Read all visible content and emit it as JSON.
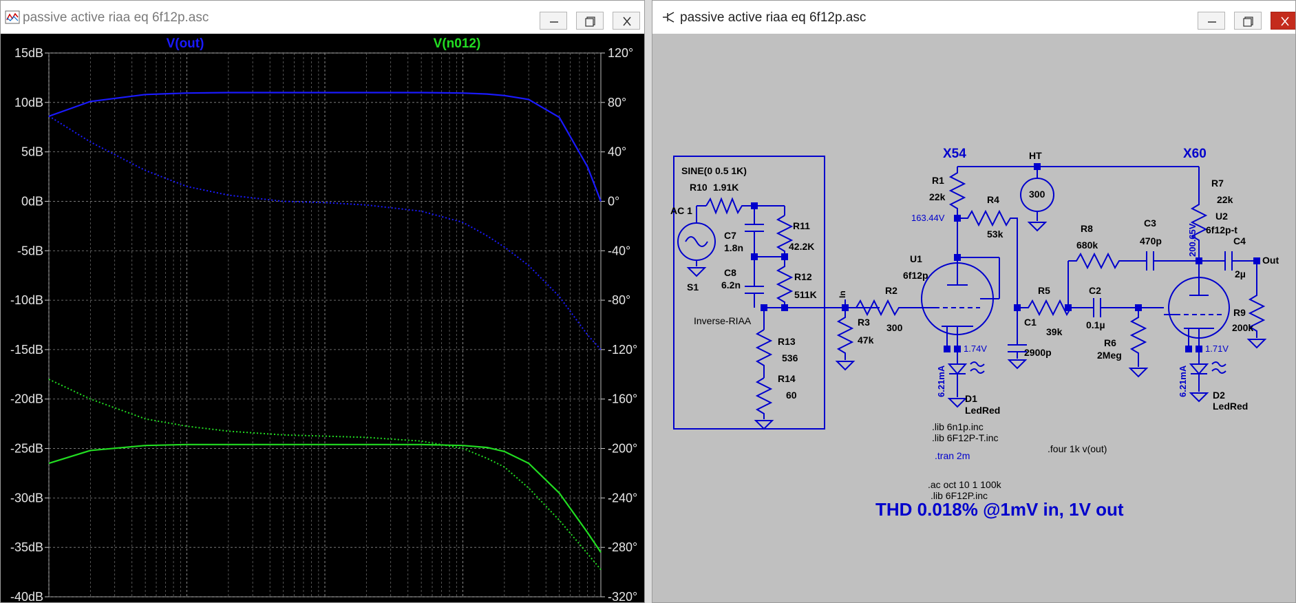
{
  "left_window": {
    "title": "passive active riaa eq 6f12p.asc",
    "traces": [
      {
        "name": "V(out)",
        "color": "#1a1aff"
      },
      {
        "name": "V(n012)",
        "color": "#22dd22"
      }
    ]
  },
  "right_window": {
    "title": "passive active riaa eq 6f12p.asc"
  },
  "chart_data": {
    "type": "line",
    "x_scale": "log",
    "xlim": [
      10,
      100000
    ],
    "y_axis_left": {
      "ticks": [
        "15dB",
        "10dB",
        "5dB",
        "0dB",
        "-5dB",
        "-10dB",
        "-15dB",
        "-20dB",
        "-25dB",
        "-30dB",
        "-35dB",
        "-40dB"
      ],
      "ylim": [
        -40,
        15
      ]
    },
    "y_axis_right": {
      "ticks": [
        "120°",
        "80°",
        "40°",
        "0°",
        "-40°",
        "-80°",
        "-120°",
        "-160°",
        "-200°",
        "-240°",
        "-280°",
        "-320°"
      ],
      "ylim": [
        -320,
        120
      ]
    },
    "grid": true,
    "series": [
      {
        "name": "V(out)",
        "kind": "magnitude",
        "style": "solid",
        "color": "#1a1aff",
        "x": [
          10,
          20,
          50,
          100,
          200,
          500,
          1000,
          2000,
          5000,
          10000,
          15000,
          20000,
          30000,
          50000,
          80000,
          100000
        ],
        "y": [
          8.6,
          10.1,
          10.8,
          10.95,
          11.0,
          11.0,
          11.0,
          11.0,
          11.0,
          10.95,
          10.85,
          10.7,
          10.3,
          8.5,
          3.5,
          0.0
        ]
      },
      {
        "name": "V(out)",
        "kind": "phase",
        "style": "dotted",
        "color": "#1a1aff",
        "x": [
          10,
          20,
          50,
          100,
          200,
          500,
          1000,
          2000,
          5000,
          10000,
          15000,
          20000,
          30000,
          50000,
          80000,
          100000
        ],
        "y": [
          69,
          48,
          25,
          12,
          5,
          0,
          -1,
          -3,
          -8,
          -17,
          -28,
          -37,
          -52,
          -77,
          -108,
          -120
        ]
      },
      {
        "name": "V(n012)",
        "kind": "magnitude",
        "style": "solid",
        "color": "#22dd22",
        "x": [
          10,
          20,
          50,
          100,
          200,
          500,
          1000,
          2000,
          5000,
          10000,
          15000,
          20000,
          30000,
          50000,
          80000,
          100000
        ],
        "y": [
          -26.5,
          -25.2,
          -24.7,
          -24.6,
          -24.6,
          -24.6,
          -24.6,
          -24.6,
          -24.6,
          -24.7,
          -24.9,
          -25.3,
          -26.5,
          -29.5,
          -33.5,
          -35.5
        ]
      },
      {
        "name": "V(n012)",
        "kind": "phase",
        "style": "dotted",
        "color": "#22dd22",
        "x": [
          10,
          20,
          50,
          100,
          200,
          500,
          1000,
          2000,
          5000,
          10000,
          15000,
          20000,
          30000,
          50000,
          80000,
          100000
        ],
        "y": [
          -144,
          -160,
          -176,
          -182,
          -186,
          -189,
          -190,
          -191,
          -194,
          -200,
          -208,
          -215,
          -232,
          -258,
          -285,
          -298
        ]
      }
    ]
  },
  "schematic": {
    "box_labels": {
      "source": "SINE(0 0.5 1K)",
      "ac": "AC 1",
      "s1": "S1",
      "inverse": "Inverse-RIAA"
    },
    "parts": [
      {
        "ref": "R10",
        "value": "1.91K"
      },
      {
        "ref": "C7",
        "value": "1.8n"
      },
      {
        "ref": "C8",
        "value": "6.2n"
      },
      {
        "ref": "R11",
        "value": "42.2K"
      },
      {
        "ref": "R12",
        "value": "511K"
      },
      {
        "ref": "R13",
        "value": "536"
      },
      {
        "ref": "R14",
        "value": "60"
      },
      {
        "ref": "R3",
        "value": "47k"
      },
      {
        "ref": "R2",
        "value": "300"
      },
      {
        "ref": "U1",
        "value": "6f12p"
      },
      {
        "ref": "R1",
        "value": "22k"
      },
      {
        "ref": "R4",
        "value": "53k"
      },
      {
        "ref": "C1",
        "value": "2900p"
      },
      {
        "ref": "R5",
        "value": "39k"
      },
      {
        "ref": "D1",
        "value": "LedRed"
      },
      {
        "ref": "R8",
        "value": "680k"
      },
      {
        "ref": "C3",
        "value": "470p"
      },
      {
        "ref": "C2",
        "value": "0.1µ"
      },
      {
        "ref": "R6",
        "value": "2Meg"
      },
      {
        "ref": "R7",
        "value": "22k"
      },
      {
        "ref": "U2",
        "value": "6f12p-t"
      },
      {
        "ref": "C4",
        "value": "2µ"
      },
      {
        "ref": "R9",
        "value": "200k"
      },
      {
        "ref": "D2",
        "value": "LedRed"
      },
      {
        "ref": "HT",
        "value": "300"
      }
    ],
    "net_labels": {
      "x54": "X54",
      "x60": "X60",
      "ht": "HT",
      "in": "In",
      "out": "Out"
    },
    "node_voltages": {
      "u1_anode": "163.44V",
      "u1_cathode": "1.74V",
      "u1_current": "6.21mA",
      "u2_anode": "200.65V",
      "u2_cathode": "1.71V",
      "u2_current": "6.21mA"
    },
    "directives": [
      ".lib 6n1p.inc",
      ".lib 6F12P-T.inc",
      ".tran 2m",
      ".ac oct 10 1 100k",
      ".lib 6F12P.inc",
      ".four 1k v(out)"
    ],
    "note": "THD 0.018% @1mV in, 1V out"
  }
}
